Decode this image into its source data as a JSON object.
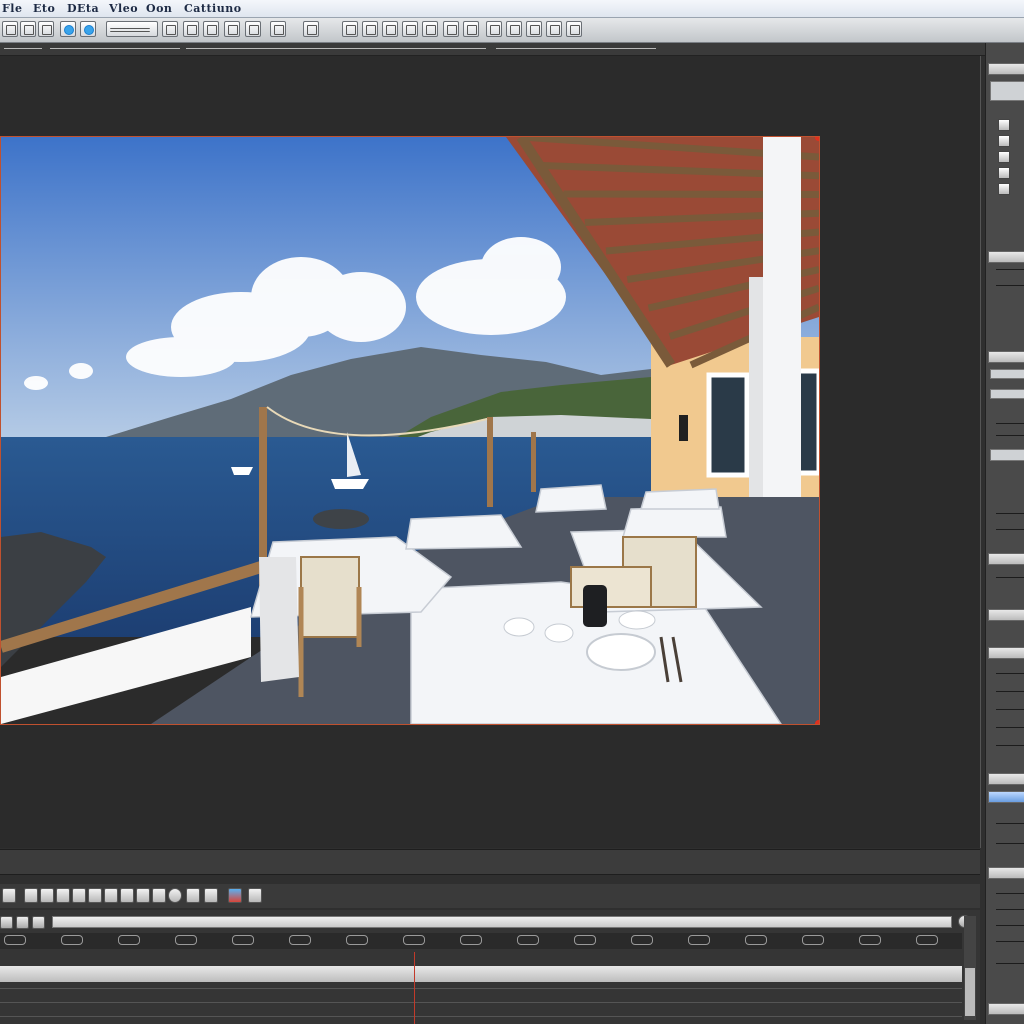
{
  "menubar": {
    "items": [
      "Fle",
      "Eto",
      "DEta",
      "Vleo",
      "Oon",
      "Cattiuno"
    ]
  },
  "viewport": {
    "scene": "sea-terrace-restaurant",
    "colors": {
      "sky_top": "#3d73c9",
      "sky_bottom": "#b8cde6",
      "sea": "#1d3f73",
      "mountain": "#5f6c78",
      "hill_green": "#49653a",
      "wall": "#f1c98f",
      "tablecloth": "#f3f5f8",
      "floor": "#4e5562",
      "roof_tile": "#9a4a36",
      "beam": "#7a5a3a",
      "frame_border": "#c0512f"
    }
  },
  "timeline": {
    "playhead_fraction": 0.43
  },
  "right_panel": {
    "active_tab_color": "#6a9de0"
  }
}
